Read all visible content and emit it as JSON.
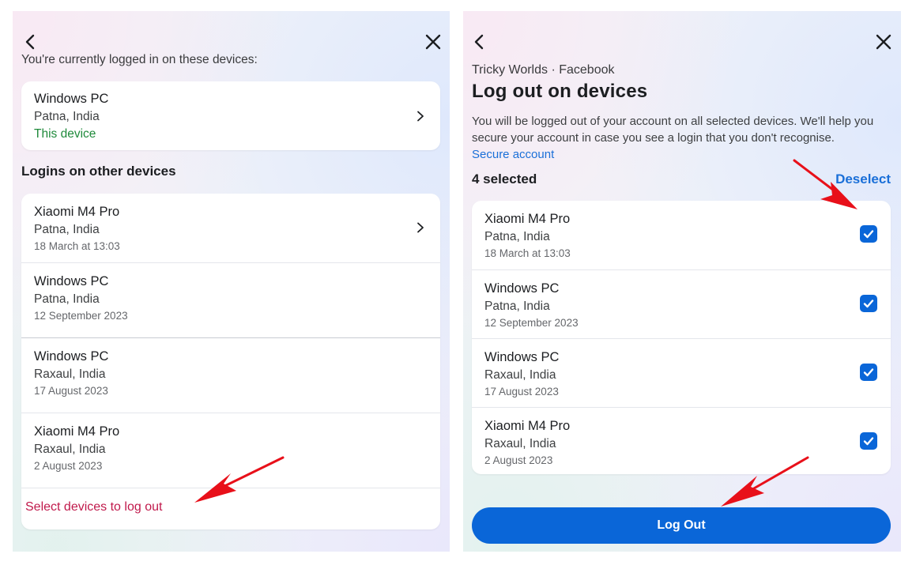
{
  "left": {
    "intro": "You're currently logged in on these devices:",
    "current_device": {
      "name": "Windows PC",
      "location": "Patna, India",
      "status": "This device"
    },
    "other_heading": "Logins on other devices",
    "other_devices": [
      {
        "name": "Xiaomi M4 Pro",
        "location": "Patna, India",
        "date": "18 March at 13:03"
      },
      {
        "name": "Windows PC",
        "location": "Patna, India",
        "date": "12 September 2023"
      },
      {
        "name": "Windows PC",
        "location": "Raxaul, India",
        "date": "17 August 2023"
      },
      {
        "name": "Xiaomi M4 Pro",
        "location": "Raxaul, India",
        "date": "2 August 2023"
      }
    ],
    "select_link": "Select devices to log out"
  },
  "right": {
    "subtitle": "Tricky Worlds · Facebook",
    "title": "Log out on devices",
    "description": "You will be logged out of your account on all selected devices. We'll help you secure your account in case you see a login that you don't recognise.",
    "secure_link": "Secure account",
    "selected_count": "4 selected",
    "deselect_label": "Deselect",
    "devices": [
      {
        "name": "Xiaomi M4 Pro",
        "location": "Patna, India",
        "date": "18 March at 13:03",
        "checked": true
      },
      {
        "name": "Windows PC",
        "location": "Patna, India",
        "date": "12 September 2023",
        "checked": true
      },
      {
        "name": "Windows PC",
        "location": "Raxaul, India",
        "date": "17 August 2023",
        "checked": true
      },
      {
        "name": "Xiaomi M4 Pro",
        "location": "Raxaul, India",
        "date": "2 August 2023",
        "checked": true
      }
    ],
    "logout_label": "Log Out"
  },
  "colors": {
    "accent_blue": "#0a66d8",
    "link_red": "#c0194b",
    "this_device_green": "#1f8a3b",
    "annotation_red": "#e8101a"
  },
  "icons": {
    "back": "chevron-left-icon",
    "close": "close-icon",
    "row_chevron": "chevron-right-icon",
    "checkbox": "checkmark-icon"
  }
}
